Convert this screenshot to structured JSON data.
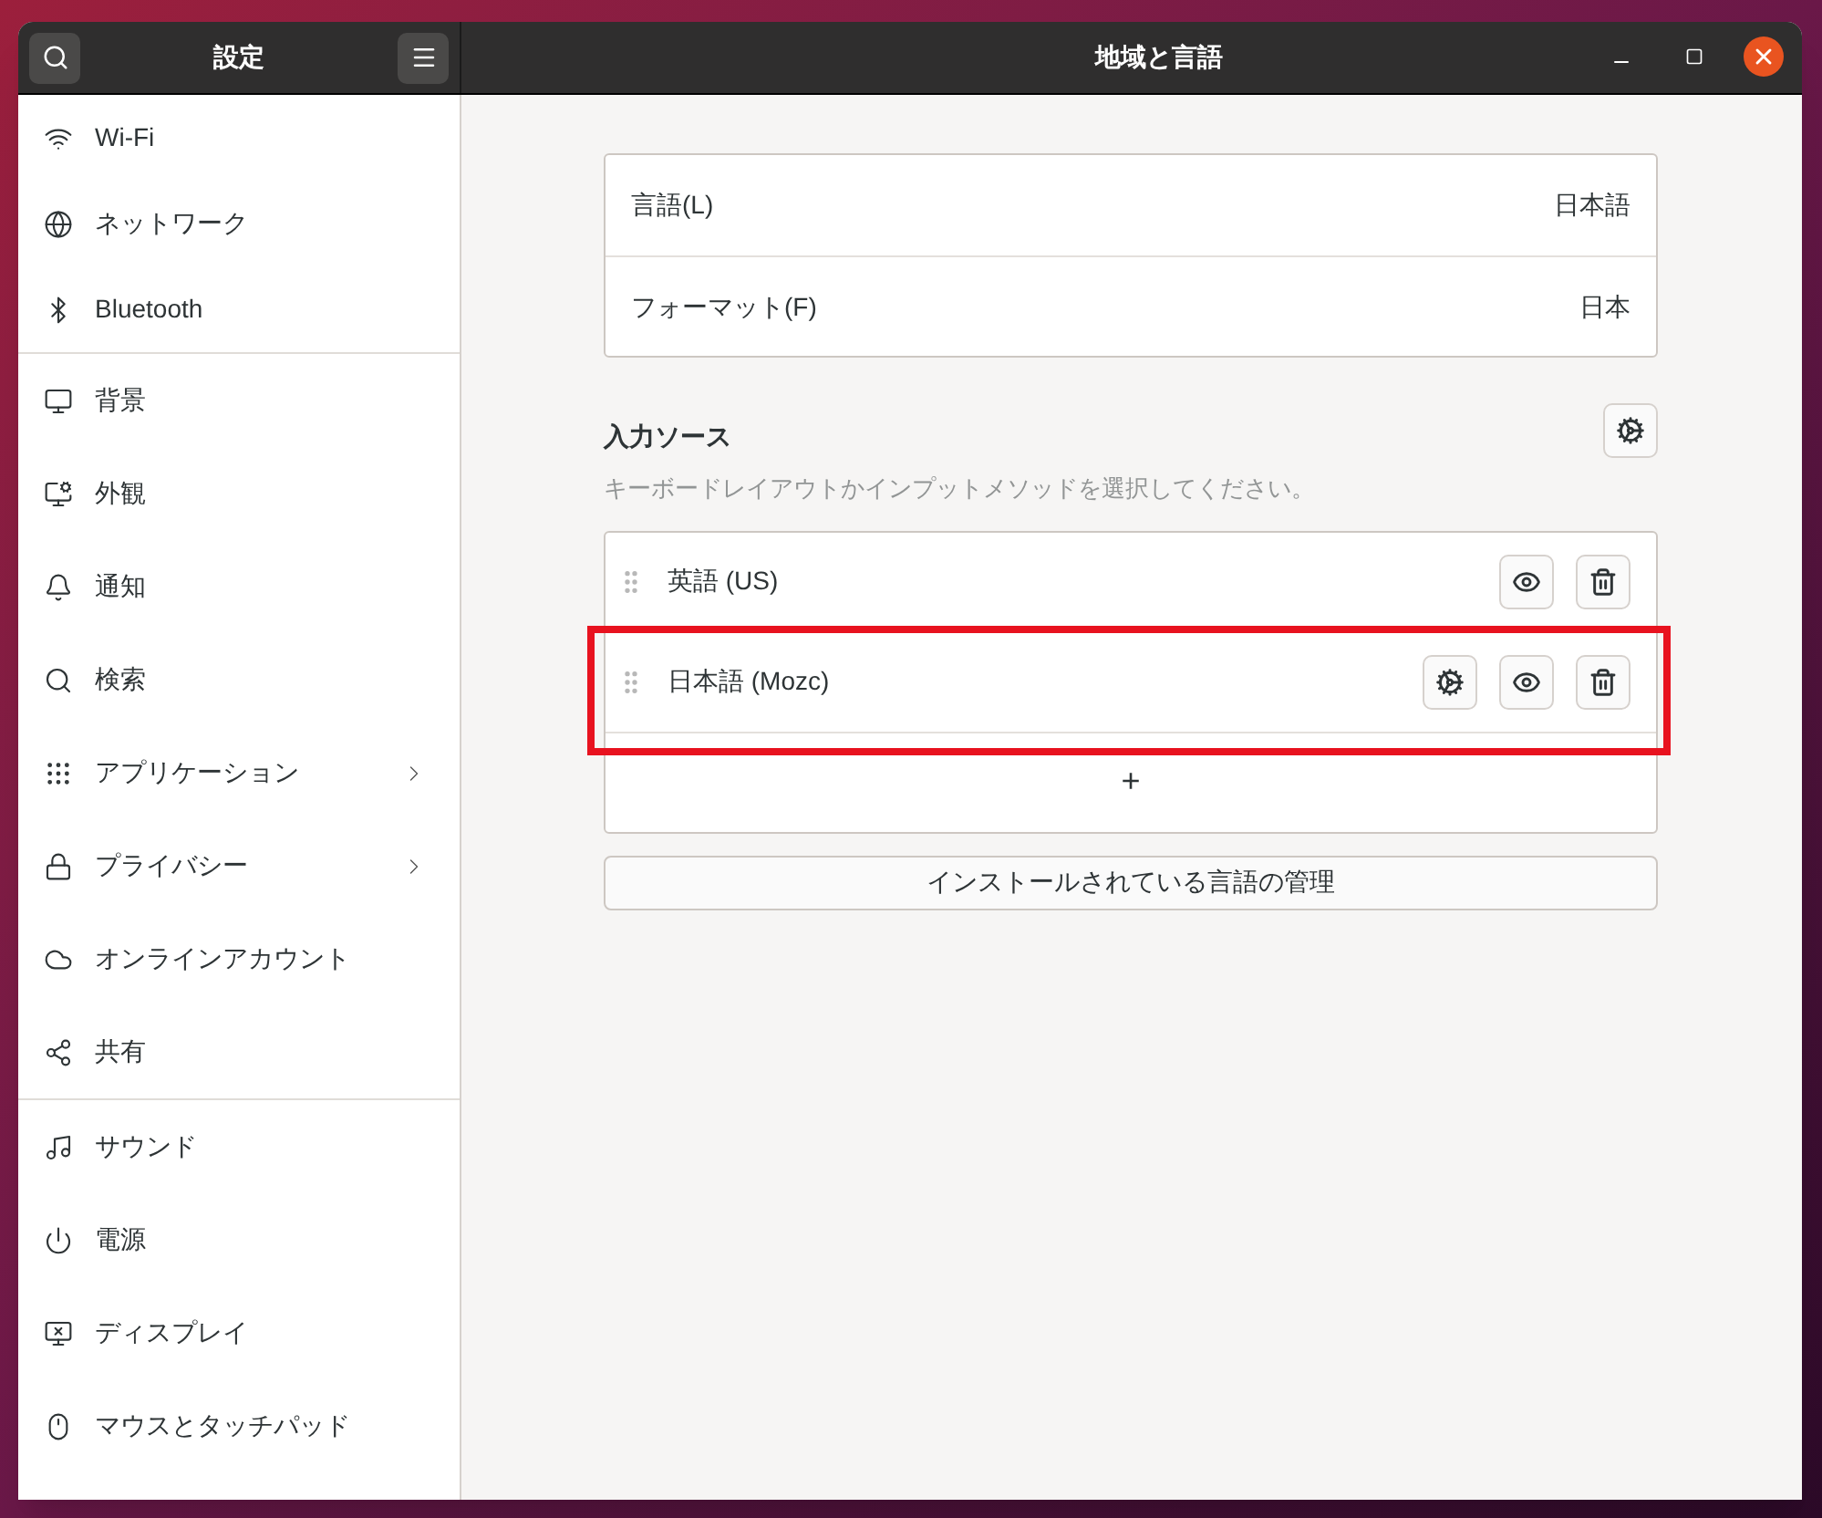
{
  "sidebar": {
    "title": "設定",
    "groups": [
      [
        {
          "label": "Wi-Fi",
          "has_submenu": false
        },
        {
          "label": "ネットワーク",
          "has_submenu": false
        },
        {
          "label": "Bluetooth",
          "has_submenu": false
        }
      ],
      [
        {
          "label": "背景",
          "has_submenu": false
        },
        {
          "label": "外観",
          "has_submenu": false
        },
        {
          "label": "通知",
          "has_submenu": false
        },
        {
          "label": "検索",
          "has_submenu": false
        },
        {
          "label": "アプリケーション",
          "has_submenu": true
        },
        {
          "label": "プライバシー",
          "has_submenu": true
        },
        {
          "label": "オンラインアカウント",
          "has_submenu": false
        },
        {
          "label": "共有",
          "has_submenu": false
        }
      ],
      [
        {
          "label": "サウンド",
          "has_submenu": false
        },
        {
          "label": "電源",
          "has_submenu": false
        },
        {
          "label": "ディスプレイ",
          "has_submenu": false
        },
        {
          "label": "マウスとタッチパッド",
          "has_submenu": false
        }
      ]
    ]
  },
  "window": {
    "title": "地域と言語"
  },
  "language_settings": [
    {
      "label": "言語(L)",
      "value": "日本語"
    },
    {
      "label": "フォーマット(F)",
      "value": "日本"
    }
  ],
  "input_sources": {
    "title": "入力ソース",
    "subtitle": "キーボードレイアウトかインプットメソッドを選択してください。",
    "rows": [
      {
        "label": "英語 (US)",
        "has_settings": false,
        "highlighted": false
      },
      {
        "label": "日本語 (Mozc)",
        "has_settings": true,
        "highlighted": true
      }
    ],
    "add_label": "+"
  },
  "manage_button": "インストールされている言語の管理"
}
